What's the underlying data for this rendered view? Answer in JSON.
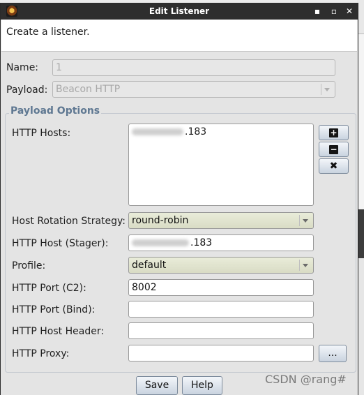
{
  "window": {
    "title": "Edit Listener"
  },
  "title_buttons": {
    "minimize": "▪",
    "maximize": "▫",
    "close": "✕"
  },
  "description": "Create a listener.",
  "name": {
    "label": "Name:",
    "value": "1"
  },
  "payload": {
    "label": "Payload:",
    "value": "Beacon HTTP"
  },
  "payload_options": {
    "title": "Payload Options",
    "http_hosts": {
      "label": "HTTP Hosts:",
      "host_suffix": ".183"
    },
    "host_buttons": {
      "add": "+",
      "remove": "−",
      "clear": "✖"
    },
    "host_rotation": {
      "label": "Host Rotation Strategy:",
      "value": "round-robin"
    },
    "stager_host": {
      "label": "HTTP Host (Stager):",
      "suffix": ".183"
    },
    "profile": {
      "label": "Profile:",
      "value": "default"
    },
    "port_c2": {
      "label": "HTTP Port (C2):",
      "value": "8002"
    },
    "port_bind": {
      "label": "HTTP Port (Bind):",
      "value": ""
    },
    "host_header": {
      "label": "HTTP Host Header:",
      "value": ""
    },
    "proxy": {
      "label": "HTTP Proxy:",
      "value": "",
      "browse_label": "..."
    }
  },
  "buttons": {
    "save": "Save",
    "help": "Help"
  },
  "watermark": "CSDN @rang#",
  "colors": {
    "titlebar": "#2e2e2e",
    "group_title": "#5f7892",
    "combo": "#e3e6d0"
  }
}
